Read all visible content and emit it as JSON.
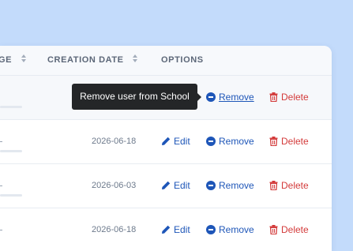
{
  "table": {
    "columns": {
      "progress_partial": "GE",
      "creation_date": "CREATION DATE",
      "options": "OPTIONS"
    },
    "actions": {
      "edit": "Edit",
      "remove": "Remove",
      "delete": "Delete"
    },
    "rows": [
      {
        "creation_date": ""
      },
      {
        "creation_date": "2026-06-18"
      },
      {
        "creation_date": "2026-06-03"
      },
      {
        "creation_date": "2026-06-18"
      }
    ]
  },
  "tooltip": {
    "text": "Remove user from School"
  },
  "colors": {
    "background": "#c3dbfb",
    "link": "#1e56b8",
    "danger": "#d33a3a",
    "tooltip": "#242628"
  }
}
